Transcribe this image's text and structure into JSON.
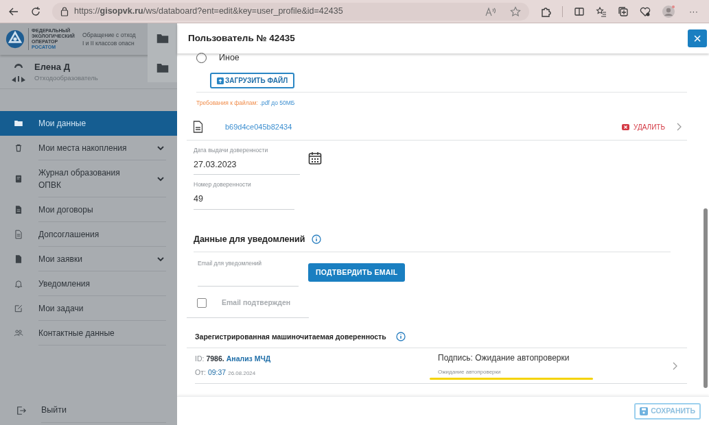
{
  "browser": {
    "url": "https://**gisopvk.ru**/ws/databoard?ent=edit&key=user_profile&id=42435",
    "menu": "···"
  },
  "sidebar": {
    "logo_lines": [
      "ФЕДЕРАЛЬНЫЙ",
      "ЭКОЛОГИЧЕСКИЙ",
      "ОПЕРАТОР",
      "РОСАТОМ"
    ],
    "header_lines": [
      "Обращение с отход",
      "I и II классов опасн"
    ],
    "user": {
      "name": "Елена Д",
      "role": "Отходообразователь"
    },
    "items": [
      {
        "kind": "folder",
        "label": "Мои данные",
        "expandable": false,
        "selected": true
      },
      {
        "kind": "trash",
        "label": "Мои места накопления",
        "expandable": true,
        "selected": false
      },
      {
        "kind": "journal",
        "label": "Журнал образования ОПВК",
        "expandable": true,
        "selected": false
      },
      {
        "kind": "file-filled",
        "label": "Мои договоры",
        "expandable": false,
        "selected": false
      },
      {
        "kind": "file-outline",
        "label": "Допсоглашения",
        "expandable": false,
        "selected": false
      },
      {
        "kind": "file-blank",
        "label": "Мои заявки",
        "expandable": true,
        "selected": false
      },
      {
        "kind": "bell",
        "label": "Уведомления",
        "expandable": false,
        "selected": false
      },
      {
        "kind": "edit",
        "label": "Мои задачи",
        "expandable": false,
        "selected": false
      },
      {
        "kind": "people",
        "label": "Контактные данные",
        "expandable": false,
        "selected": false
      }
    ],
    "logout": "Выйти"
  },
  "modal": {
    "title": "Пользователь № 42435",
    "close": "×",
    "radio": {
      "label": "Иное",
      "selected": false
    },
    "upload_button": "ЗАГРУЗИТЬ ФАЙЛ",
    "requirements": {
      "label": "Требования к файлам:",
      "value": ".pdf до 50МБ"
    },
    "file": {
      "name": "b69d4ce045b82434",
      "delete": "УДАЛИТЬ"
    },
    "fields": [
      {
        "label": "Дата выдачи доверенности",
        "value": "27.03.2023",
        "kind": "date"
      },
      {
        "label": "Номер доверенности",
        "value": "49",
        "kind": "text"
      }
    ],
    "notifications": {
      "title": "Данные для уведомлений",
      "email_label": "Email для уведомлений",
      "confirm_button": "ПОДТВЕРДИТЬ EMAIL",
      "confirmed": {
        "label": "Email подтвержден",
        "checked": false
      }
    },
    "poa": {
      "title": "Зарегистрированная машиночитаемая доверенность",
      "rows": [
        {
          "id_label": "ID:",
          "id": "7986.",
          "name": "Анализ МЧД",
          "from_label": "От:",
          "time": "09:37",
          "date": "26.08.2024",
          "status": "Подпись: Ожидание автопроверки",
          "substatus": "Ожидание автопроверки",
          "highlighted": true
        }
      ]
    },
    "save_button": "СОХРАНИТЬ"
  }
}
